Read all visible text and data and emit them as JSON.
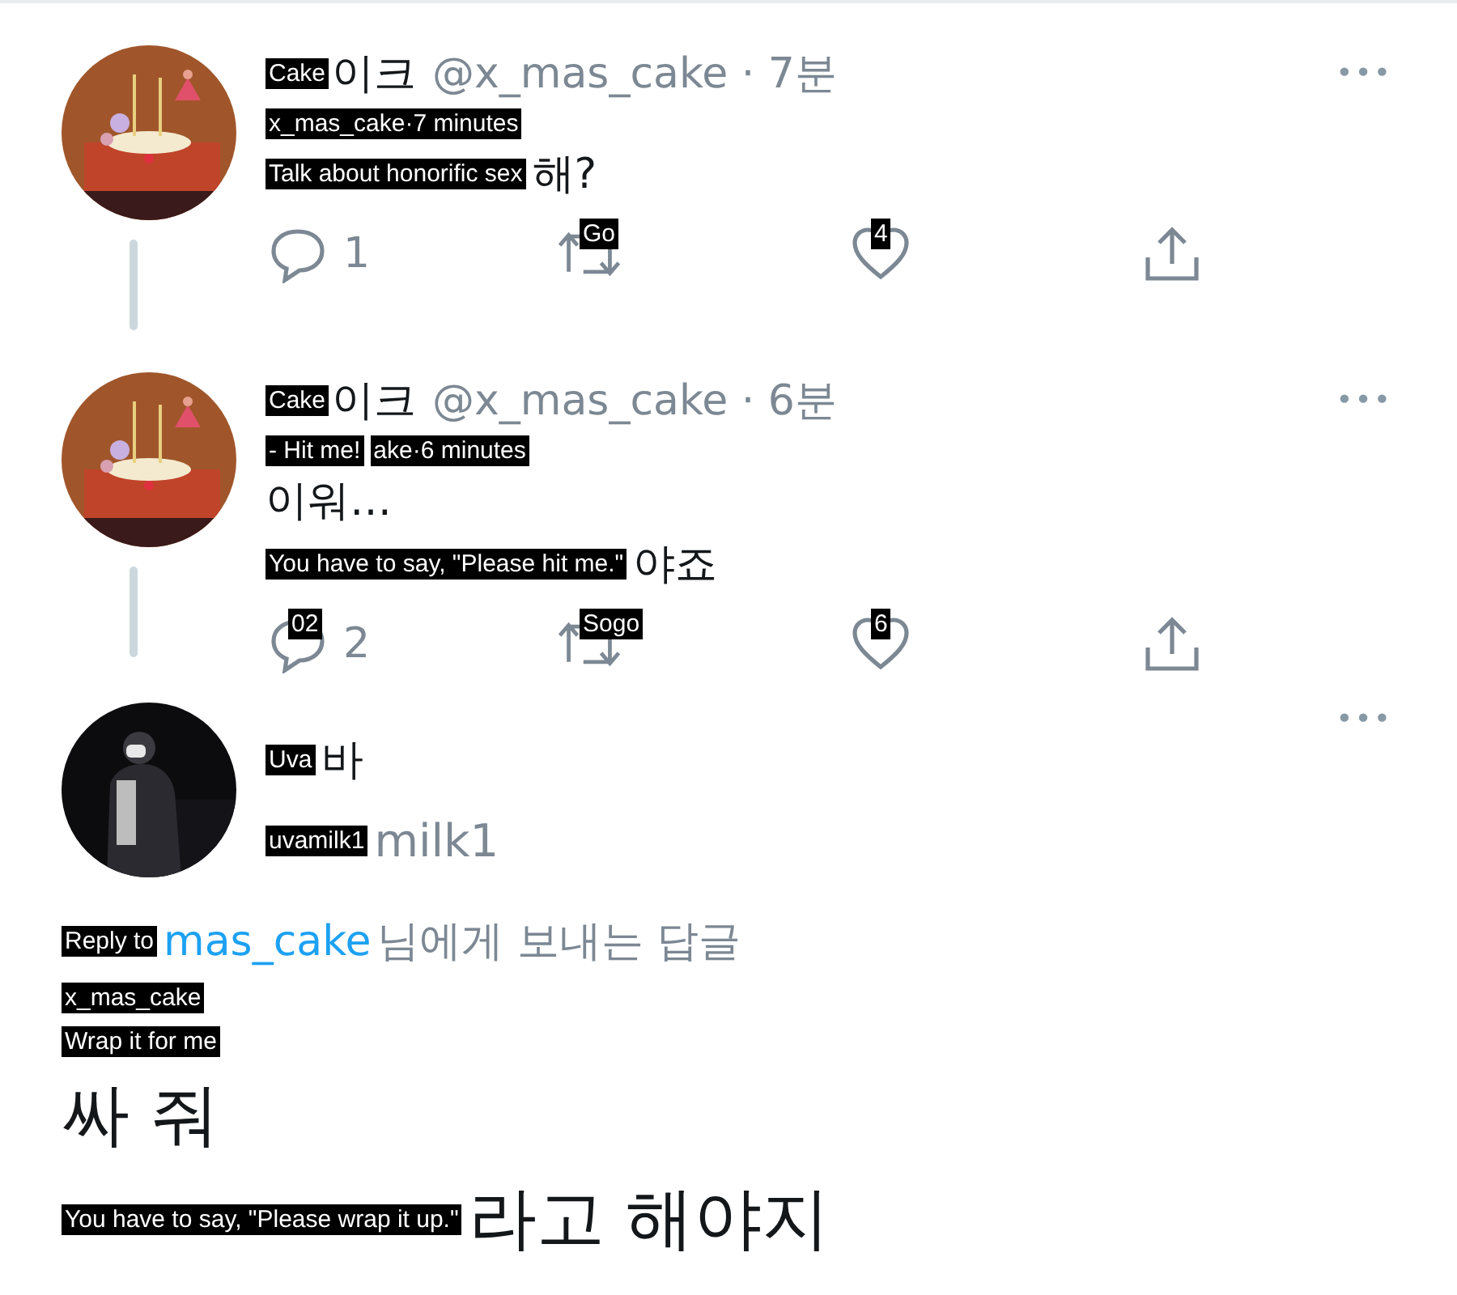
{
  "thread": [
    {
      "name_label": "Cake",
      "name": "이크",
      "handle": "@x_mas_cake",
      "separator": "·",
      "time": "7분",
      "more": "•••",
      "lines": [
        [
          {
            "kind": "overlay",
            "text": "x_mas_cake·7 minutes"
          }
        ],
        [
          {
            "kind": "overlay",
            "text": "Talk about honorific sex"
          },
          {
            "kind": "text",
            "text": "해?"
          }
        ]
      ],
      "actions": [
        {
          "kind": "reply",
          "count": "1"
        },
        {
          "kind": "retweet",
          "label": "Go"
        },
        {
          "kind": "like",
          "label": "4"
        },
        {
          "kind": "share"
        }
      ]
    },
    {
      "name_label": "Cake",
      "name": "이크",
      "handle": "@x_mas_cake",
      "separator": "·",
      "time": "6분",
      "more": "•••",
      "lines": [
        [
          {
            "kind": "overlay",
            "text": "- Hit me!"
          },
          {
            "kind": "overlay",
            "text": "ake·6 minutes"
          }
        ],
        [
          {
            "kind": "text",
            "text": "이워…"
          }
        ],
        [
          {
            "kind": "overlay",
            "text": "You have to say, \"Please hit me.\""
          },
          {
            "kind": "text",
            "text": "야죠"
          }
        ]
      ],
      "actions": [
        {
          "kind": "reply",
          "label": "02",
          "count": "2"
        },
        {
          "kind": "retweet",
          "label": "Sogo"
        },
        {
          "kind": "like",
          "label": "6"
        },
        {
          "kind": "share"
        }
      ]
    }
  ],
  "reply": {
    "name_label": "Uva",
    "name": "바",
    "handle_label": "uvamilk1",
    "handle": "milk1",
    "more": "•••",
    "reply_to": [
      {
        "kind": "overlay",
        "text": "Reply to"
      },
      {
        "kind": "link",
        "text": "mas_cake"
      },
      {
        "kind": "text",
        "text": "님에게 보내는 답글"
      }
    ],
    "lines": [
      [
        {
          "kind": "overlay",
          "text": "x_mas_cake"
        }
      ],
      [
        {
          "kind": "overlay",
          "text": "Wrap it for me"
        }
      ],
      [
        {
          "kind": "text",
          "text": "싸 줘"
        }
      ],
      [
        {
          "kind": "overlay",
          "text": "You have to say, \"Please wrap it up.\""
        },
        {
          "kind": "text",
          "text": "라고 해야지"
        }
      ]
    ]
  }
}
